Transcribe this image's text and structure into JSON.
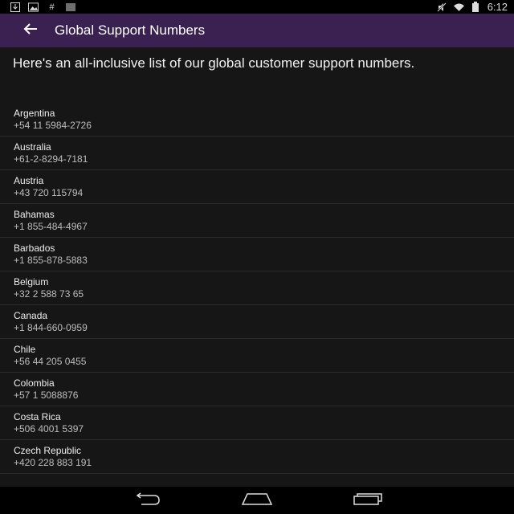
{
  "status_bar": {
    "time": "6:12",
    "left_icons": [
      "download-icon",
      "photo-icon",
      "hashtag-icon",
      "barcode-icon"
    ],
    "right_icons": [
      "mute-icon",
      "wifi-icon",
      "battery-icon"
    ]
  },
  "app_bar": {
    "title": "Global Support Numbers",
    "back_icon": "arrow-left-icon"
  },
  "intro_text": "Here's an all-inclusive list of our global customer support numbers.",
  "entries": [
    {
      "country": "Argentina",
      "phone": "+54 11 5984-2726"
    },
    {
      "country": "Australia",
      "phone": "+61-2-8294-7181"
    },
    {
      "country": "Austria",
      "phone": "+43 720 115794"
    },
    {
      "country": "Bahamas",
      "phone": "+1 855-484-4967"
    },
    {
      "country": "Barbados",
      "phone": "+1 855-878-5883"
    },
    {
      "country": "Belgium",
      "phone": "+32 2 588 73 65"
    },
    {
      "country": "Canada",
      "phone": "+1 844-660-0959"
    },
    {
      "country": "Chile",
      "phone": "+56 44 205 0455"
    },
    {
      "country": "Colombia",
      "phone": "+57 1 5088876"
    },
    {
      "country": "Costa Rica",
      "phone": "+506 4001 5397"
    },
    {
      "country": "Czech Republic",
      "phone": "+420 228 883 191"
    }
  ],
  "nav_bar": {
    "icons": [
      "back-nav-icon",
      "home-nav-icon",
      "recents-nav-icon"
    ]
  },
  "colors": {
    "app_bar": "#3b2151",
    "background": "#161616",
    "divider": "#2b2b2b"
  }
}
